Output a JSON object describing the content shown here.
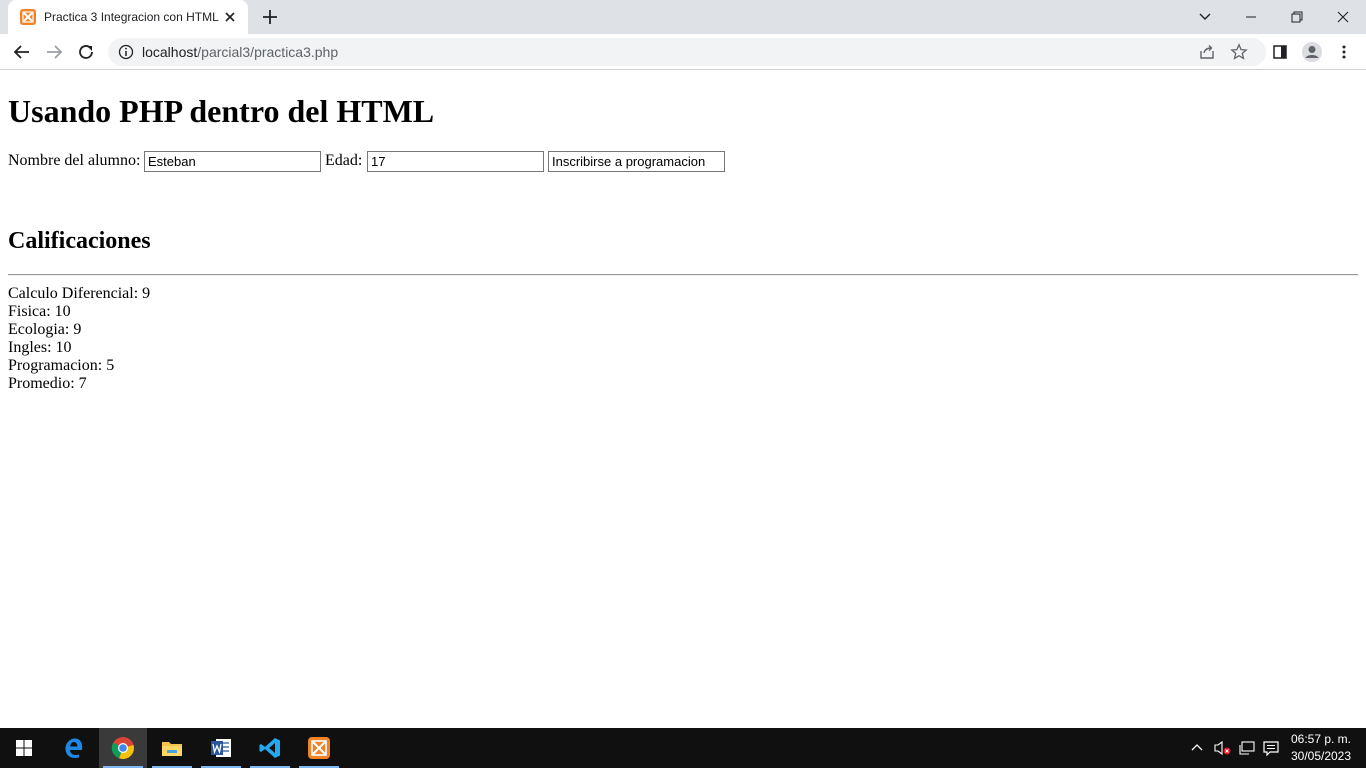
{
  "browser": {
    "tab_title": "Practica 3 Integracion con HTML",
    "url_host": "localhost",
    "url_path": "/parcial3/practica3.php"
  },
  "page": {
    "heading": "Usando PHP dentro del HTML",
    "form": {
      "name_label": "Nombre del alumno:",
      "name_value": "Esteban",
      "age_label": "Edad:",
      "age_value": "17",
      "enroll_value": "Inscribirse a programacion"
    },
    "grades_heading": "Calificaciones",
    "grades": [
      "Calculo Diferencial: 9",
      "Fisica: 10",
      "Ecologia: 9",
      "Ingles: 10",
      "Programacion: 5",
      "Promedio: 7"
    ]
  },
  "taskbar": {
    "apps": [
      "windows-start",
      "edge",
      "chrome",
      "file-explorer",
      "word",
      "vscode",
      "xampp"
    ],
    "time": "06:57 p. m.",
    "date": "30/05/2023"
  },
  "colors": {
    "tabstrip": "#dee1e6",
    "omnibox": "#f1f3f4",
    "taskbar": "#101010",
    "xampp_orange": "#f08228"
  }
}
